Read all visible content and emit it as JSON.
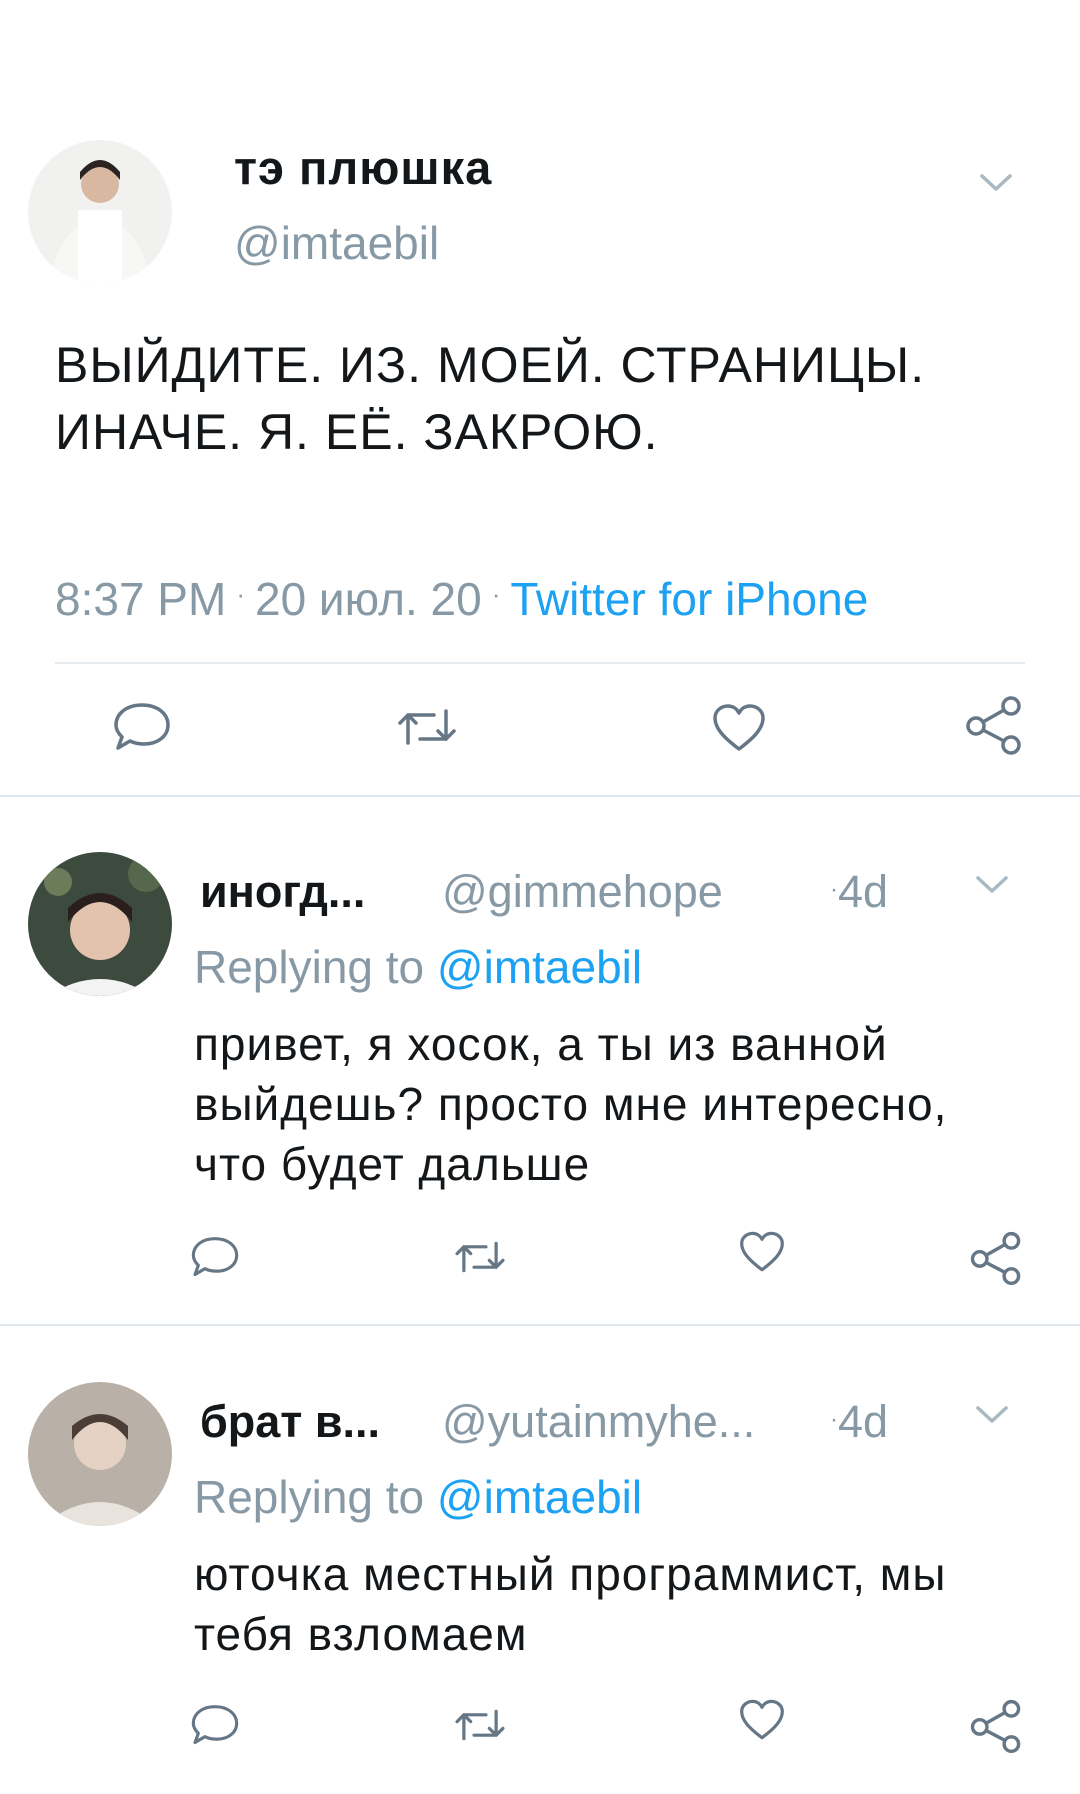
{
  "main_tweet": {
    "display_name": "тэ плюшка",
    "handle": "@imtaebil",
    "text": "ВЫЙДИТЕ. ИЗ. МОЕЙ. СТРАНИЦЫ. ИНАЧЕ. Я. ЕЁ. ЗАКРОЮ.",
    "time": "8:37 PM",
    "separator": "·",
    "date": "20 июл. 20",
    "source": "Twitter for iPhone"
  },
  "replies": [
    {
      "display_name": "иногд...",
      "handle": "@gimmehope",
      "separator": "·",
      "time": "4d",
      "replying_prefix": "Replying to",
      "replying_to": "@imtaebil",
      "text": "привет, я хосок, а ты из ванной выйдешь? просто мне интересно, что будет дальше"
    },
    {
      "display_name": "брат в...",
      "handle": "@yutainmyhe...",
      "separator": "·",
      "time": "4d",
      "replying_prefix": "Replying to",
      "replying_to": "@imtaebil",
      "text": "юточка местный программист, мы тебя взломаем"
    }
  ],
  "icons": {
    "more": "chevron-down-icon",
    "reply": "reply-bubble-icon",
    "retweet": "retweet-icon",
    "like": "heart-icon",
    "share": "share-icon"
  },
  "colors": {
    "accent": "#1da1f2",
    "secondary_text": "#8899a6",
    "text": "#14171a",
    "divider": "#e1e8ed"
  }
}
